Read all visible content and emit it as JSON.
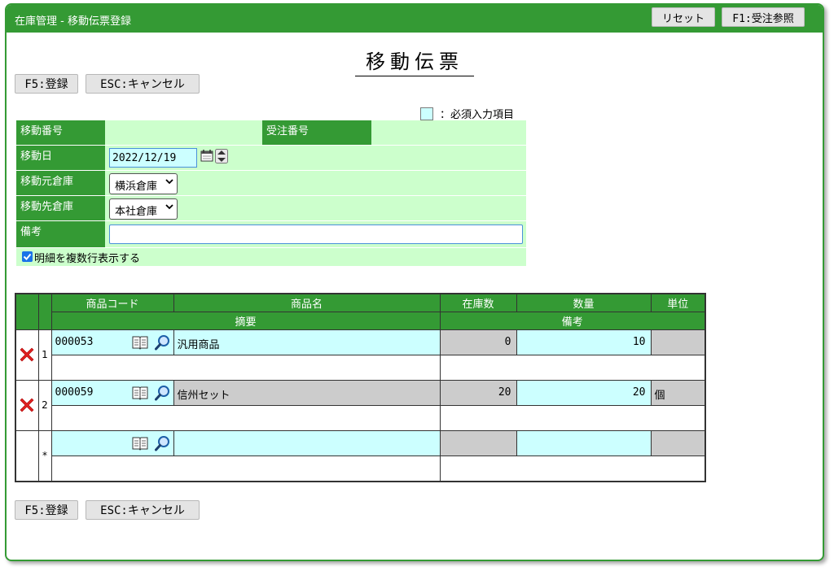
{
  "header": {
    "app_title": "在庫管理 - 移動伝票登録",
    "reset_label": "リセット",
    "order_ref_label": "F1:受注参照"
  },
  "page": {
    "title": "移動伝票"
  },
  "toolbar": {
    "register_label": "F5:登録",
    "cancel_label": "ESC:キャンセル"
  },
  "legend": {
    "text": "：必須入力項目"
  },
  "form": {
    "move_no_label": "移動番号",
    "move_no_value": "",
    "order_no_label": "受注番号",
    "order_no_value": "",
    "move_date_label": "移動日",
    "move_date_value": "2022/12/19",
    "from_wh_label": "移動元倉庫",
    "from_wh_value": "横浜倉庫",
    "to_wh_label": "移動先倉庫",
    "to_wh_value": "本社倉庫",
    "memo_label": "備考",
    "memo_value": "",
    "multiline_label": "明細を複数行表示する",
    "multiline_checked": true
  },
  "table": {
    "headers": {
      "code": "商品コード",
      "name": "商品名",
      "stock": "在庫数",
      "qty": "数量",
      "unit": "単位",
      "summary": "摘要",
      "remarks": "備考"
    },
    "rows": [
      {
        "no": "1",
        "code": "000053",
        "name": "汎用商品",
        "stock": "0",
        "qty": "10",
        "unit": ""
      },
      {
        "no": "2",
        "code": "000059",
        "name": "信州セット",
        "stock": "20",
        "qty": "20",
        "unit": "個"
      }
    ],
    "new_row_marker": "*"
  },
  "colors": {
    "header_green": "#349a34",
    "light_green": "#ccffcc",
    "required_cyan": "#ccffff",
    "readonly_gray": "#cccccc"
  }
}
